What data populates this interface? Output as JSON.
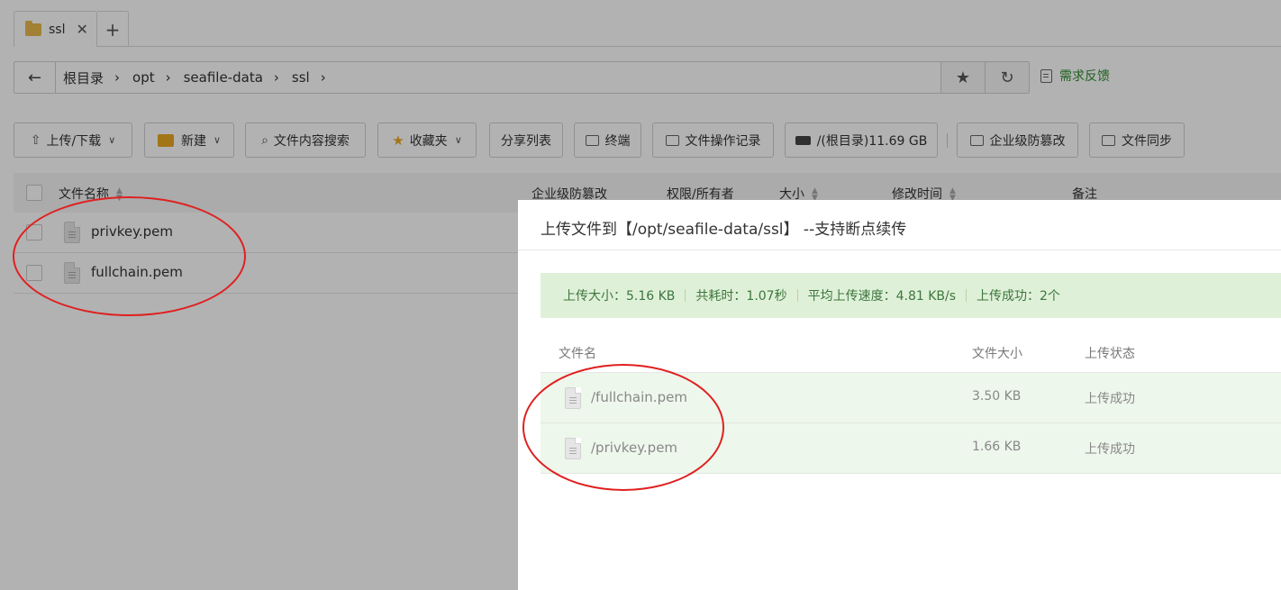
{
  "tab": {
    "label": "ssl",
    "close": "✕",
    "add": "+"
  },
  "address": {
    "crumbs": [
      "根目录",
      "opt",
      "seafile-data",
      "ssl"
    ],
    "separator": "›"
  },
  "feedback_label": "需求反馈",
  "toolbar": {
    "upload_download": "上传/下载",
    "new": "新建",
    "content_search": "文件内容搜索",
    "favorites": "收藏夹",
    "share_list": "分享列表",
    "terminal": "终端",
    "file_op_log": "文件操作记录",
    "disk": "/(根目录)11.69 GB",
    "tamper_protection": "企业级防篡改",
    "file_sync": "文件同步"
  },
  "table": {
    "headers": {
      "name": "文件名称",
      "tamper": "企业级防篡改",
      "perm": "权限/所有者",
      "size": "大小",
      "mtime": "修改时间",
      "note": "备注"
    },
    "rows": [
      {
        "name": "privkey.pem"
      },
      {
        "name": "fullchain.pem"
      }
    ]
  },
  "modal": {
    "title": "上传文件到【/opt/seafile-data/ssl】 --支持断点续传",
    "summary": {
      "size": "上传大小：5.16 KB",
      "elapsed": "共耗时：1.07秒",
      "speed": "平均上传速度：4.81 KB/s",
      "success": "上传成功：2个"
    },
    "headers": {
      "name": "文件名",
      "size": "文件大小",
      "status": "上传状态"
    },
    "rows": [
      {
        "name": "/fullchain.pem",
        "size": "3.50 KB",
        "status": "上传成功"
      },
      {
        "name": "/privkey.pem",
        "size": "1.66 KB",
        "status": "上传成功"
      }
    ]
  },
  "colors": {
    "annotation": "#e02020",
    "success_bg": "#dff0d8",
    "success_text": "#3c763d"
  }
}
